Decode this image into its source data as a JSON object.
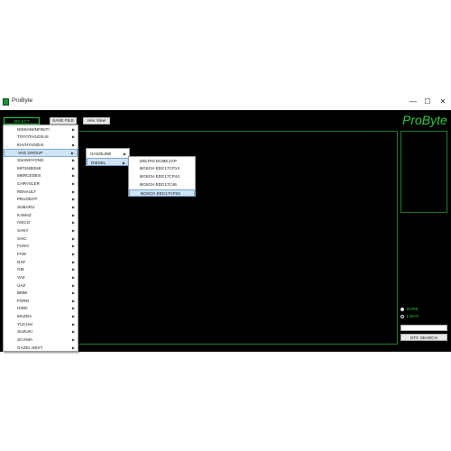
{
  "window": {
    "title": "ProByte",
    "min": "—",
    "max": "☐",
    "close": "✕"
  },
  "toolbar": {
    "select_module": "SELECT MODULE",
    "save_file": "SAVE FILE",
    "hex_view": "Hex View"
  },
  "logo": "ProByte",
  "menu1": {
    "items": [
      "NISSAN/INFINITI",
      "TOYOTA/LEXUS",
      "KIA/HYUNDAI",
      "VAG GROUP",
      "SSANGYONG",
      "MITSUBISHI",
      "MERCEDES",
      "CHRYSLER",
      "RENAULT",
      "PEUGEOT",
      "SUBARU",
      "KAMAZ",
      "IVECO",
      "SANY",
      "SAIC",
      "FUSO",
      "FAW",
      "DAF",
      "GM",
      "VAZ",
      "UAZ",
      "BMW",
      "FORD",
      "HINO",
      "MAZDA",
      "YUCHAI",
      "SUZUKI",
      "SCANIA",
      "GAZEL NEXT"
    ],
    "highlighted": "VAG GROUP"
  },
  "menu2": {
    "items": [
      "GASOLINE",
      "DIESEL"
    ],
    "highlighted": "DIESEL"
  },
  "menu3": {
    "items": [
      "DELPHI DCM6.2AP",
      "BOSCH EDC17CP14",
      "BOSCH EDC17CP44",
      "BOSCH EDC17C46",
      "BOSCH EDC17CP20"
    ],
    "highlighted": "BOSCH EDC17CP20"
  },
  "theme": {
    "dark_label": "DARK",
    "light_label": "LIGHT",
    "selected": "DARK"
  },
  "dtc": {
    "search_label": "DTC SEARCH",
    "value": ""
  },
  "colors": {
    "accent": "#2ecc40",
    "background": "#000000",
    "highlight": "#cfe3f5"
  }
}
